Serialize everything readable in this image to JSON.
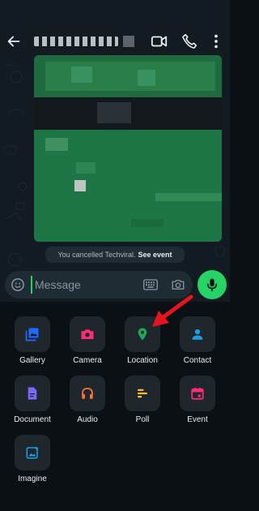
{
  "header": {
    "contact_name_redacted": true
  },
  "chat": {
    "system_message": "You cancelled Techviral.",
    "system_link": "See event"
  },
  "composer": {
    "placeholder": "Message"
  },
  "attachments": {
    "items": [
      {
        "label": "Gallery",
        "icon": "gallery-icon",
        "color": "#1e6bff"
      },
      {
        "label": "Camera",
        "icon": "camera-icon",
        "color": "#ff2e74"
      },
      {
        "label": "Location",
        "icon": "location-pin-icon",
        "color": "#1fa855"
      },
      {
        "label": "Contact",
        "icon": "contact-icon",
        "color": "#1a9ee8"
      },
      {
        "label": "Document",
        "icon": "document-icon",
        "color": "#7f66ff"
      },
      {
        "label": "Audio",
        "icon": "headphones-icon",
        "color": "#ff6d3a"
      },
      {
        "label": "Poll",
        "icon": "poll-icon",
        "color": "#ffbc38"
      },
      {
        "label": "Event",
        "icon": "event-icon",
        "color": "#ff2e74"
      },
      {
        "label": "Imagine",
        "icon": "imagine-icon",
        "color": "#1a9ee8"
      }
    ]
  },
  "colors": {
    "accent": "#25d366",
    "annotation_arrow": "#e8141b"
  }
}
